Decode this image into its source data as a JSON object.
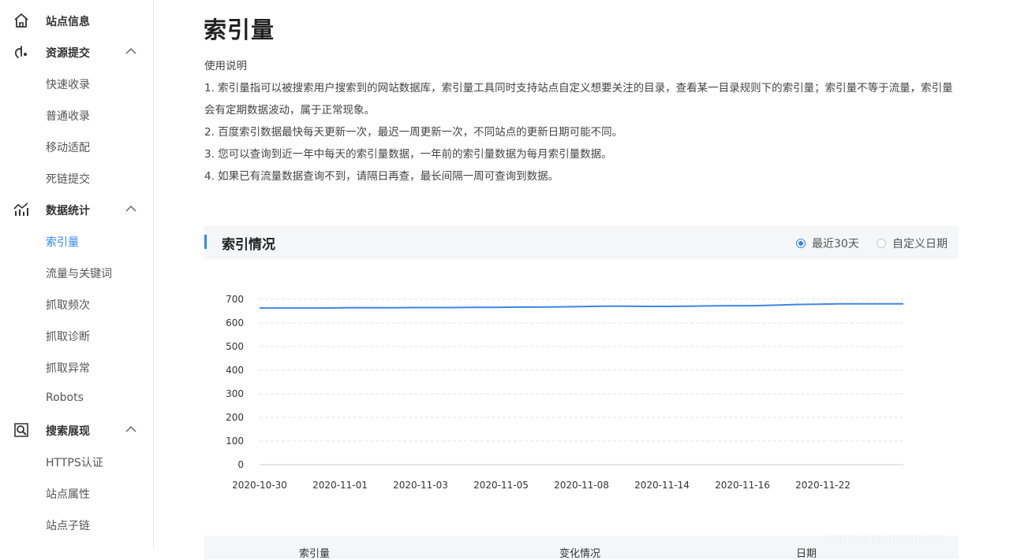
{
  "sidebar": {
    "groups": [
      {
        "label": "站点信息",
        "icon": "home-icon"
      },
      {
        "label": "资源提交",
        "icon": "submit-icon",
        "expanded": true,
        "items": [
          "快速收录",
          "普通收录",
          "移动适配",
          "死链提交"
        ]
      },
      {
        "label": "数据统计",
        "icon": "stats-icon",
        "expanded": true,
        "items": [
          "索引量",
          "流量与关键词",
          "抓取频次",
          "抓取诊断",
          "抓取异常",
          "Robots"
        ]
      },
      {
        "label": "搜索展现",
        "icon": "search-display-icon",
        "expanded": true,
        "items": [
          "HTTPS认证",
          "站点属性",
          "站点子链"
        ]
      }
    ],
    "active_item": "索引量"
  },
  "page": {
    "title": "索引量",
    "usage_title": "使用说明",
    "usage_lines": [
      "1. 索引量指可以被搜索用户搜索到的网站数据库，索引量工具同时支持站点自定义想要关注的目录，查看某一目录规则下的索引量；索引量不等于流量，索引量会有定期数据波动，属于正常现象。",
      "2. 百度索引数据最快每天更新一次，最迟一周更新一次，不同站点的更新日期可能不同。",
      "3. 您可以查询到近一年中每天的索引量数据，一年前的索引量数据为每月索引量数据。",
      "4. 如果已有流量数据查询不到，请隔日再查，最长间隔一周可查询到数据。"
    ]
  },
  "section": {
    "title": "索引情况",
    "radio_options": [
      {
        "label": "最近30天",
        "selected": true
      },
      {
        "label": "自定义日期",
        "selected": false
      }
    ]
  },
  "chart_data": {
    "type": "line",
    "x_ticks": [
      "2020-10-30",
      "2020-11-01",
      "2020-11-03",
      "2020-11-05",
      "2020-11-08",
      "2020-11-14",
      "2020-11-16",
      "2020-11-22"
    ],
    "y_ticks": [
      0,
      100,
      200,
      300,
      400,
      500,
      600,
      700
    ],
    "ylim": [
      0,
      700
    ],
    "series": [
      {
        "values": [
          663,
          663,
          663,
          663,
          664,
          664,
          664,
          665,
          665,
          665,
          666,
          666,
          667,
          667,
          668,
          669,
          671,
          671,
          670,
          670,
          671,
          672,
          673,
          673,
          675,
          678,
          679,
          681,
          681,
          681,
          681
        ]
      }
    ],
    "line_color": "#3e86e6",
    "grid": true
  },
  "table": {
    "headers": [
      "索引量",
      "变化情况",
      "日期"
    ]
  },
  "watermark": "https://blog.csdn.net"
}
